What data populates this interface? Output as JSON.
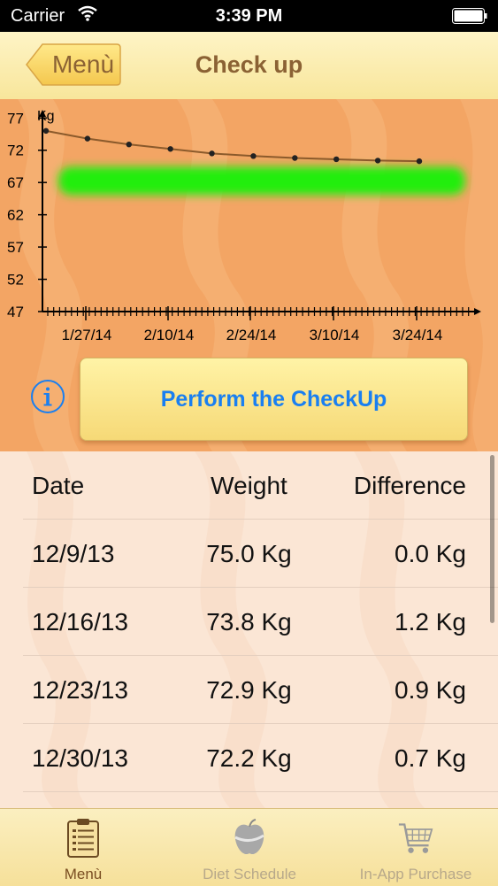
{
  "status_bar": {
    "carrier": "Carrier",
    "time": "3:39 PM"
  },
  "nav": {
    "back_label": "Menù",
    "title": "Check up"
  },
  "chart_data": {
    "type": "line",
    "ylabel": "Kg",
    "y_ticks": [
      47,
      52,
      57,
      62,
      67,
      72,
      77
    ],
    "ylim": [
      47,
      78
    ],
    "x_tick_labels": [
      "1/27/14",
      "2/10/14",
      "2/24/14",
      "3/10/14",
      "3/24/14"
    ],
    "series": [
      {
        "values": [
          75.0,
          73.8,
          72.9,
          72.2,
          71.5,
          71.1,
          70.8,
          70.6,
          70.4,
          70.3
        ]
      }
    ],
    "target_band": [
      67,
      67.5
    ],
    "colors": {
      "line": "#8b5a2b",
      "band": "#22ee11"
    }
  },
  "checkup": {
    "button_label": "Perform the CheckUp",
    "info_icon": "info-icon"
  },
  "table": {
    "headers": {
      "date": "Date",
      "weight": "Weight",
      "difference": "Difference"
    },
    "rows": [
      {
        "date": "12/9/13",
        "weight": "75.0 Kg",
        "difference": "0.0 Kg"
      },
      {
        "date": "12/16/13",
        "weight": "73.8 Kg",
        "difference": "1.2 Kg"
      },
      {
        "date": "12/23/13",
        "weight": "72.9 Kg",
        "difference": "0.9 Kg"
      },
      {
        "date": "12/30/13",
        "weight": "72.2 Kg",
        "difference": "0.7 Kg"
      }
    ]
  },
  "tabs": [
    {
      "label": "Menù",
      "icon": "clipboard-icon",
      "active": true
    },
    {
      "label": "Diet Schedule",
      "icon": "apple-tape-icon",
      "active": false
    },
    {
      "label": "In-App Purchase",
      "icon": "cart-icon",
      "active": false
    }
  ]
}
